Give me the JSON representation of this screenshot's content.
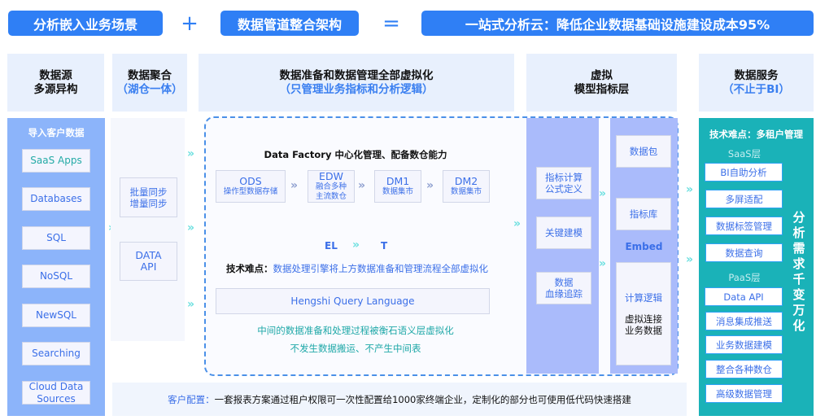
{
  "top_banner": {
    "pill_1": "分析嵌入业务场景",
    "operator_plus": "+",
    "pill_2": "数据管道整合架构",
    "operator_equals": "=",
    "pill_3": "一站式分析云：降低企业数据基础设施建设成本95%"
  },
  "headers": {
    "source": {
      "line1": "数据源",
      "line2": "多源异构"
    },
    "aggregation": {
      "line1": "数据聚合",
      "line2": "（湖仓一体）"
    },
    "virtualization": {
      "line1": "数据准备和数据管理全部虚拟化",
      "line2": "（只管理业务指标和分析逻辑）"
    },
    "model_layer": {
      "line1": "虚拟",
      "line2": "模型指标层"
    },
    "services": {
      "line1": "数据服务",
      "line2": "（不止于BI）"
    }
  },
  "sources": {
    "title": "导入客户数据",
    "items": [
      "SaaS Apps",
      "Databases",
      "SQL",
      "NoSQL",
      "NewSQL",
      "Searching",
      "Cloud Data Sources"
    ]
  },
  "aggregation": {
    "sync_box": {
      "line1": "批量同步",
      "line2": "增量同步"
    },
    "api_box": {
      "line1": "DATA",
      "line2": "API"
    }
  },
  "factory": {
    "title": "Data Factory 中心化管理、配备数仓能力",
    "stages": [
      {
        "name": "ODS",
        "desc": "操作型数据存储"
      },
      {
        "name": "EDW",
        "desc": "融合多种主流数仓"
      },
      {
        "name": "DM1",
        "desc": "数据集市"
      },
      {
        "name": "DM2",
        "desc": "数据集市"
      }
    ],
    "el_label": "EL",
    "t_label": "T",
    "difficulty_label": "技术难点：",
    "difficulty_text": "数据处理引擎将上方数据准备和管理流程全部虚拟化",
    "hql_box": "Hengshi Query Language",
    "note_1": "中间的数据准备和处理过程被衡石语义层虚拟化",
    "note_2": "不发生数据搬运、不产生中间表"
  },
  "model_layer": {
    "left_items": [
      {
        "line1": "指标计算",
        "line2": "公式定义"
      },
      {
        "line1": "关键建模",
        "line2": ""
      },
      {
        "line1": "数据",
        "line2": "血缘追踪"
      }
    ],
    "right_items": {
      "package": "数据包",
      "metric_lib": "指标库",
      "embed_label": "Embed",
      "logic_title": "计算逻辑",
      "logic_line1": "虚拟连接",
      "logic_line2": "业务数据"
    }
  },
  "services": {
    "title": "技术难点：多租户管理",
    "saas_label": "SaaS层",
    "saas_items": [
      "BI自助分析",
      "多屏适配",
      "数据标签管理",
      "数据查询"
    ],
    "paas_label": "PaaS层",
    "paas_items": [
      "Data API",
      "消息集成推送",
      "业务数据建模",
      "整合各种数仓",
      "高级数据管理"
    ],
    "vertical_text": "分析需求千变万化"
  },
  "footer": {
    "label": "客户配置：",
    "text": "一套报表方案通过租户权限可一次性配置给1000家终端企业，定制化的部分也可使用低代码快速搭建"
  },
  "arrow_glyph": "»"
}
